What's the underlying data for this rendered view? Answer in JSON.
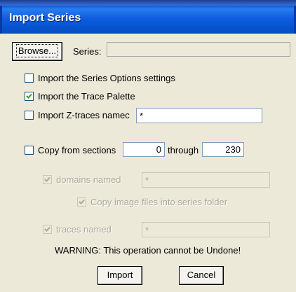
{
  "window": {
    "title": "Import Series"
  },
  "series": {
    "browse_label": "Browse...",
    "label": "Series:",
    "value": ""
  },
  "options": {
    "import_series_options": {
      "label": "Import the Series Options settings",
      "checked": false
    },
    "import_trace_palette": {
      "label": "Import the Trace Palette",
      "checked": true
    },
    "import_z_traces": {
      "label": "Import Z-traces namec",
      "checked": false,
      "value": "*"
    },
    "copy_sections": {
      "label": "Copy from sections",
      "checked": false,
      "from": "0",
      "through_label": "through",
      "to": "230"
    },
    "domains_named": {
      "label": "domains named",
      "checked": true,
      "enabled": false,
      "value": "*"
    },
    "copy_image_files": {
      "label": "Copy image files into series folder",
      "checked": true,
      "enabled": false
    },
    "traces_named": {
      "label": "traces named",
      "checked": true,
      "enabled": false,
      "value": "*"
    }
  },
  "warning": "WARNING: This operation cannot be Undone!",
  "buttons": {
    "import_label": "Import",
    "cancel_label": "Cancel"
  }
}
